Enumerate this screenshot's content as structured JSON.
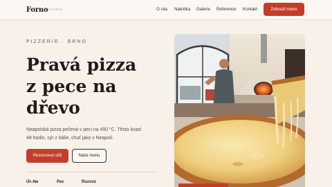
{
  "brand": {
    "name": "Forno",
    "tagline": "PIZZERIE"
  },
  "nav": {
    "items": [
      "O nás",
      "Nabídka",
      "Galerie",
      "Reference",
      "Kontakt"
    ],
    "cta": "Zobrazit menu"
  },
  "hero": {
    "kicker": "PIZZERIE · BRNO",
    "title_lines": [
      "Pravá pizza",
      "z pece na",
      "dřevo"
    ],
    "lead_lines": [
      "Neapolská pizza pečená v peci na 450 °C. Těsto kvasí",
      "48 hodin, sýr z Itálie, chuť jako v Neapoli."
    ],
    "primary_button": "Rezervovat stůl",
    "secondary_button": "Naše menu"
  },
  "hours": {
    "labels": [
      "Út–Ne",
      "Pec",
      "Rozvoz"
    ]
  },
  "photo": {
    "icon": "pizza-oven-photo",
    "accent": "#c23e2b"
  },
  "colors": {
    "accent": "#c23e2b",
    "background": "#f7f1e9",
    "text": "#231a15"
  }
}
